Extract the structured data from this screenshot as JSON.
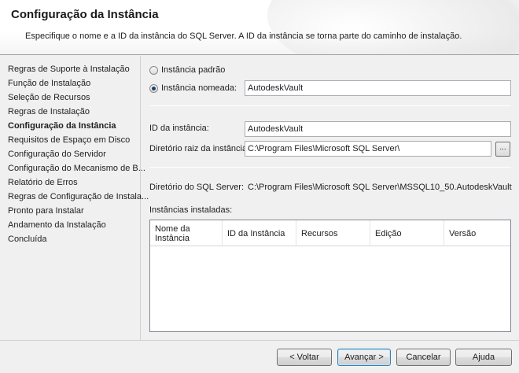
{
  "header": {
    "title": "Configuração da Instância",
    "subtitle": "Especifique o nome e a ID da instância do SQL Server. A ID da instância se torna parte do caminho de instalação."
  },
  "sidebar": {
    "items": [
      {
        "label": "Regras de Suporte à Instalação"
      },
      {
        "label": "Função de Instalação"
      },
      {
        "label": "Seleção de Recursos"
      },
      {
        "label": "Regras de Instalação"
      },
      {
        "label": "Configuração da Instância",
        "active": true
      },
      {
        "label": "Requisitos de Espaço em Disco"
      },
      {
        "label": "Configuração do Servidor"
      },
      {
        "label": "Configuração do Mecanismo de B..."
      },
      {
        "label": "Relatório de Erros"
      },
      {
        "label": "Regras de Configuração de Instala..."
      },
      {
        "label": "Pronto para Instalar"
      },
      {
        "label": "Andamento da Instalação"
      },
      {
        "label": "Concluída"
      }
    ]
  },
  "main": {
    "default_instance_label": "Instância padrão",
    "default_instance_checked": false,
    "named_instance_label": "Instância nomeada:",
    "named_instance_checked": true,
    "named_instance_value": "AutodeskVault",
    "instance_id_label": "ID da instância:",
    "instance_id_value": "AutodeskVault",
    "root_dir_label": "Diretório raiz da instância:",
    "root_dir_value": "C:\\Program Files\\Microsoft SQL Server\\",
    "browse_label": "...",
    "sql_dir_label": "Diretório do SQL Server:",
    "sql_dir_value": "C:\\Program Files\\Microsoft SQL Server\\MSSQL10_50.AutodeskVault",
    "installed_label": "Instâncias instaladas:",
    "grid_columns": [
      "Nome da Instância",
      "ID da Instância",
      "Recursos",
      "Edição",
      "Versão"
    ]
  },
  "footer": {
    "back_label": "< Voltar",
    "next_label": "Avançar >",
    "cancel_label": "Cancelar",
    "help_label": "Ajuda"
  }
}
